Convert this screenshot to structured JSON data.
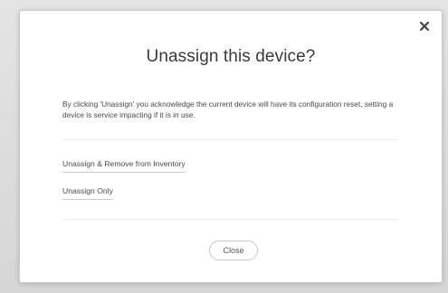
{
  "dialog": {
    "title": "Unassign this device?",
    "description": "By clicking 'Unassign' you acknowledge the current device will have its configuration reset, setting a device is service impacting if it is in use.",
    "close_icon": "close-icon",
    "actions": {
      "unassign_remove_label": "Unassign & Remove from Inventory",
      "unassign_only_label": "Unassign Only"
    },
    "close_button_label": "Close"
  },
  "colors": {
    "link_underline": "#bfd1dd",
    "title_text": "#3a3a3a",
    "body_text": "#4a4a4a"
  }
}
